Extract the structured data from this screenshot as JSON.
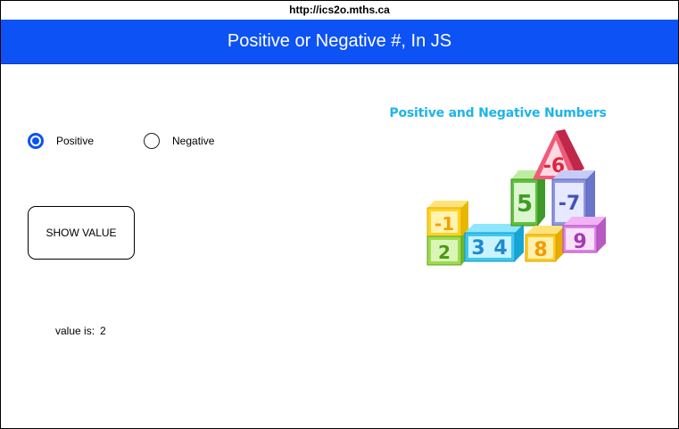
{
  "browser": {
    "url": "http://ics2o.mths.ca"
  },
  "header": {
    "title": "Positive or Negative #, In JS"
  },
  "options": [
    {
      "label": "Positive",
      "checked": true
    },
    {
      "label": "Negative",
      "checked": false
    }
  ],
  "button": {
    "label": "SHOW VALUE"
  },
  "output": {
    "label": "value is:",
    "value": "2"
  },
  "illustration": {
    "title": "Positive and Negative Numbers",
    "blocks": [
      "-1",
      "2",
      "3",
      "4",
      "5",
      "-6",
      "-7",
      "8",
      "9"
    ]
  },
  "colors": {
    "header_bg": "#0d52f5",
    "accent": "#0d52f5",
    "illustration_title": "#1eb4e8"
  }
}
